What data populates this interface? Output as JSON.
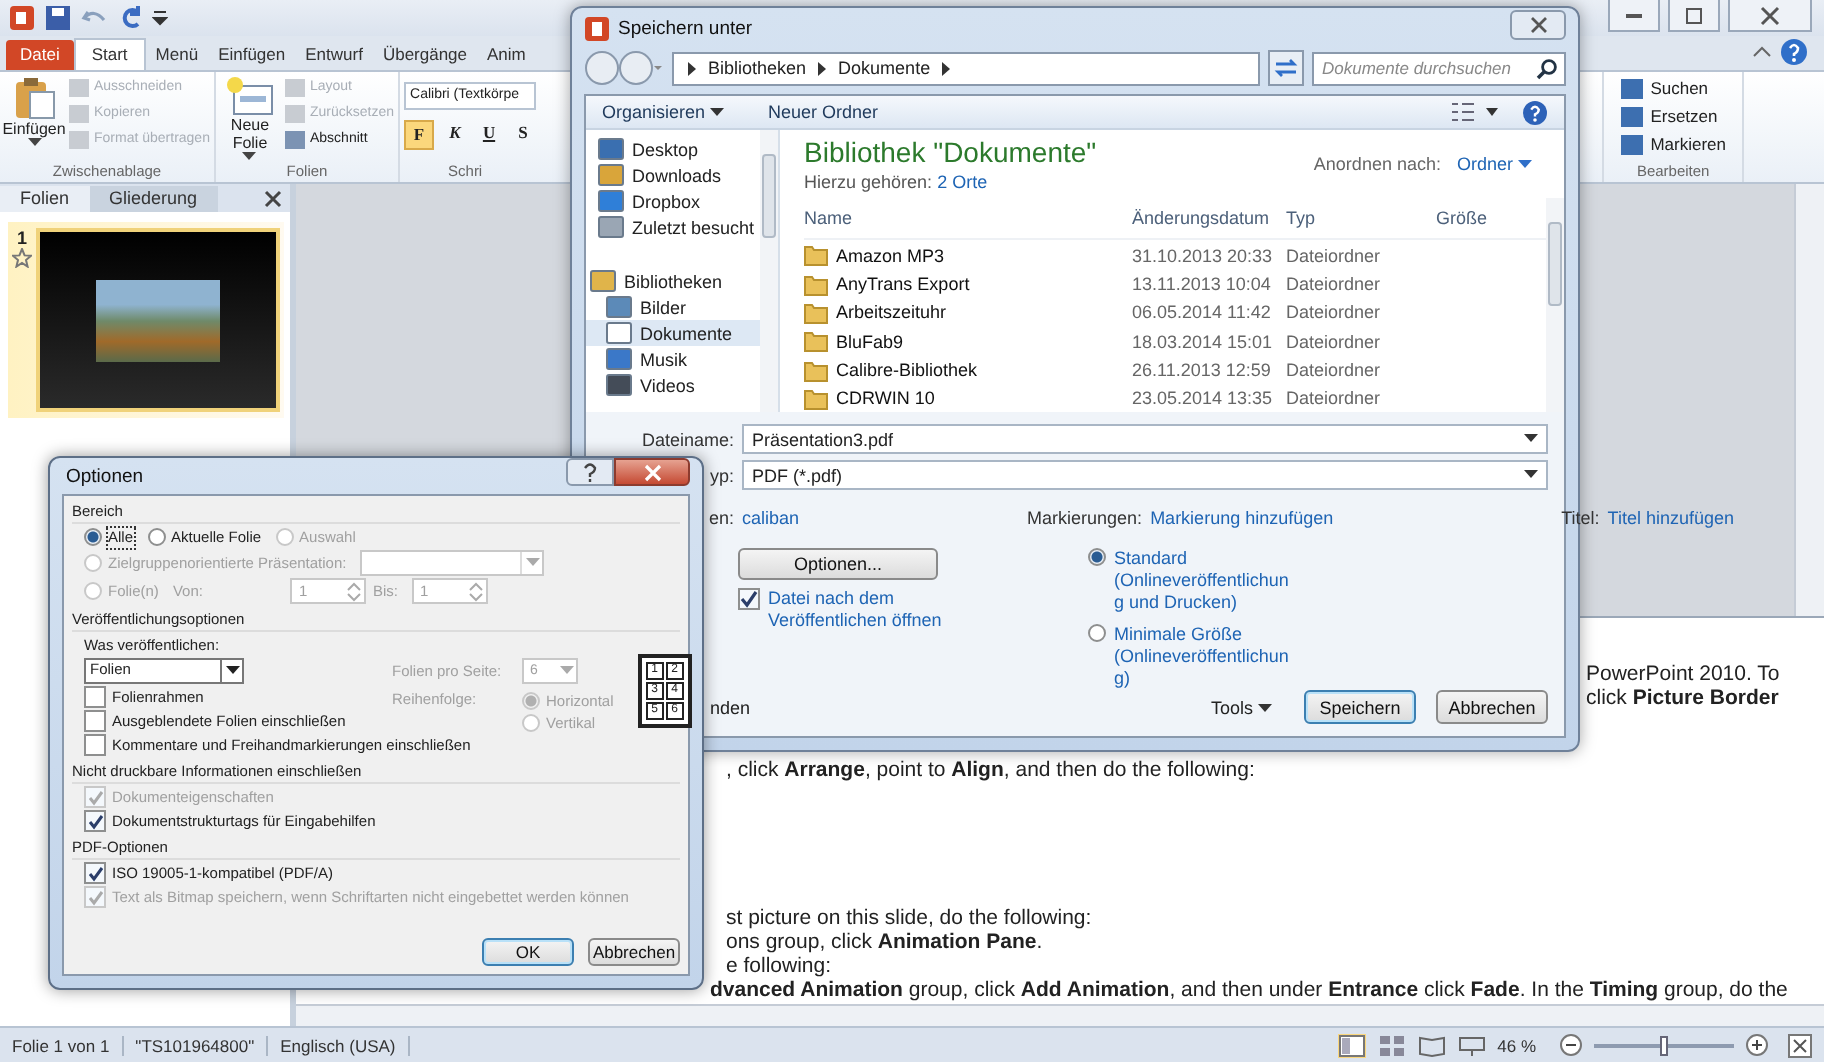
{
  "ppt": {
    "ribbon": {
      "tabs": [
        {
          "label": "Datei",
          "kind": "file",
          "selected": false
        },
        {
          "label": "Start",
          "kind": "tab",
          "selected": true
        },
        {
          "label": "Menü",
          "kind": "tab",
          "selected": false
        },
        {
          "label": "Einfügen",
          "kind": "tab",
          "selected": false
        },
        {
          "label": "Entwurf",
          "kind": "tab",
          "selected": false
        },
        {
          "label": "Übergänge",
          "kind": "tab",
          "selected": false
        },
        {
          "label": "Anim",
          "kind": "tab",
          "selected": false
        }
      ],
      "groups": [
        {
          "kind": "clipboard",
          "label": "Zwischenablage",
          "large": "Einfügen",
          "items": [
            {
              "label": "Ausschneiden",
              "disabled": true
            },
            {
              "label": "Kopieren",
              "disabled": true
            },
            {
              "label": "Format übertragen",
              "disabled": true
            }
          ]
        },
        {
          "kind": "slides",
          "label": "Folien",
          "large": "Neue Folie",
          "items": [
            {
              "label": "Layout",
              "disabled": true
            },
            {
              "label": "Zurücksetzen",
              "disabled": true
            },
            {
              "label": "Abschnitt",
              "disabled": false
            }
          ]
        },
        {
          "kind": "font",
          "label": "Schri",
          "font": "Calibri (Textkörpe",
          "buttons": [
            "F",
            "K",
            "U",
            "S"
          ]
        },
        {
          "kind": "edit",
          "label": "Bearbeiten",
          "items": [
            {
              "label": "Suchen",
              "disabled": false
            },
            {
              "label": "Ersetzen",
              "disabled": false
            },
            {
              "label": "Markieren",
              "disabled": false
            }
          ]
        }
      ]
    },
    "pane": {
      "tabs": [
        {
          "label": "Folien",
          "selected": true
        },
        {
          "label": "Gliederung",
          "selected": false
        }
      ],
      "slide_number": "1"
    },
    "notes": [
      {
        "kind": "right",
        "text": "PowerPoint 2010. To"
      },
      {
        "kind": "right",
        "text": "click **Picture Border**"
      },
      {
        "kind": "body",
        "text": ", click **Arrange**, point to **Align**, and then do the following:"
      },
      {
        "kind": "body",
        "text": "st picture on this slide, do the following:"
      },
      {
        "kind": "body",
        "text": "ons group, click **Animation Pane**."
      },
      {
        "kind": "body",
        "text": "e following:"
      },
      {
        "kind": "wide",
        "text": "**dvanced Animation** group, click **Add Animation**, and then under **Entrance** click **Fade**. In the **Timing** group, do the"
      }
    ],
    "status_bar": {
      "slide": "Folie 1 von 1",
      "theme": "\"TS101964800\"",
      "language": "Englisch (USA)",
      "zoom": "46 %",
      "zoom_slider": {
        "level": 0.5
      }
    }
  },
  "save_dialog": {
    "title": "Speichern unter",
    "breadcrumb": [
      "Bibliotheken",
      "Dokumente"
    ],
    "search": {
      "placeholder": "Dokumente durchsuchen"
    },
    "toolbar": {
      "organize": "Organisieren",
      "new_folder": "Neuer Ordner"
    },
    "nav": [
      {
        "label": "Desktop",
        "kind": "desktop",
        "selected": false
      },
      {
        "label": "Downloads",
        "kind": "downloads",
        "selected": false
      },
      {
        "label": "Dropbox",
        "kind": "dropbox",
        "selected": false
      },
      {
        "label": "Zuletzt besucht",
        "kind": "recent",
        "selected": false
      },
      {
        "label": "Bibliotheken",
        "kind": "libraries",
        "selected": false
      },
      {
        "label": "Bilder",
        "kind": "pictures",
        "selected": false
      },
      {
        "label": "Dokumente",
        "kind": "documents",
        "selected": true
      },
      {
        "label": "Musik",
        "kind": "music",
        "selected": false
      },
      {
        "label": "Videos",
        "kind": "videos",
        "selected": false
      }
    ],
    "library": {
      "title": "Bibliothek \"Dokumente\"",
      "includes_label": "Hierzu gehören:",
      "includes_link": "2 Orte",
      "sort_label": "Anordnen nach:",
      "sort_value": "Ordner"
    },
    "columns": [
      "Name",
      "Änderungsdatum",
      "Typ",
      "Größe"
    ],
    "rows": [
      {
        "name": "Amazon MP3",
        "date": "31.10.2013 20:33",
        "type": "Dateiordner"
      },
      {
        "name": "AnyTrans Export",
        "date": "13.11.2013 10:04",
        "type": "Dateiordner"
      },
      {
        "name": "Arbeitszeituhr",
        "date": "06.05.2014 11:42",
        "type": "Dateiordner"
      },
      {
        "name": "BluFab9",
        "date": "18.03.2014 15:01",
        "type": "Dateiordner"
      },
      {
        "name": "Calibre-Bibliothek",
        "date": "26.11.2013 12:59",
        "type": "Dateiordner"
      },
      {
        "name": "CDRWIN 10",
        "date": "23.05.2014 13:35",
        "type": "Dateiordner"
      }
    ],
    "fields": [
      {
        "label": "Dateiname:",
        "value": "Präsentation3.pdf"
      },
      {
        "label": "yp:",
        "value": "PDF (*.pdf)"
      }
    ],
    "meta": [
      {
        "label": "en:",
        "value": "caliban"
      },
      {
        "label": "Markierungen:",
        "value": "Markierung hinzufügen"
      },
      {
        "label": "Titel:",
        "value": "Titel hinzufügen"
      }
    ],
    "options_button": "Optionen...",
    "open_after": {
      "label": "Datei nach dem Veröffentlichen öffnen",
      "checked": true
    },
    "optimize": [
      {
        "label": "Standard (Onlineveröffentlichung und Drucken)",
        "selected": true
      },
      {
        "label": "Minimale Größe (Onlineveröffentlichung)",
        "selected": false
      }
    ],
    "hide_folders": "nden",
    "tools": "Tools",
    "buttons": [
      "Speichern",
      "Abbrechen"
    ]
  },
  "options_dialog": {
    "title": "Optionen",
    "range": {
      "heading": "Bereich",
      "choices": [
        {
          "label": "Alle",
          "selected": true,
          "disabled": false
        },
        {
          "label": "Aktuelle Folie",
          "selected": false,
          "disabled": false
        },
        {
          "label": "Auswahl",
          "selected": false,
          "disabled": true
        },
        {
          "label": "Zielgruppenorientierte Präsentation:",
          "selected": false,
          "disabled": true
        },
        {
          "label": "Folie(n)",
          "selected": false,
          "disabled": true
        }
      ],
      "from_label": "Von:",
      "from": "1",
      "to_label": "Bis:",
      "to": "1"
    },
    "publish": {
      "heading": "Veröffentlichungsoptionen",
      "what_label": "Was veröffentlichen:",
      "what": "Folien",
      "per_page_label": "Folien pro Seite:",
      "per_page": "6",
      "order_label": "Reihenfolge:",
      "order": [
        {
          "label": "Horizontal",
          "selected": true
        },
        {
          "label": "Vertikal",
          "selected": false
        }
      ],
      "layout_numbers": [
        "1",
        "2",
        "3",
        "4",
        "5",
        "6"
      ],
      "checks": [
        {
          "label": "Folienrahmen",
          "checked": false,
          "disabled": false
        },
        {
          "label": "Ausgeblendete Folien einschließen",
          "checked": false,
          "disabled": false
        },
        {
          "label": "Kommentare und Freihandmarkierungen einschließen",
          "checked": false,
          "disabled": false
        }
      ]
    },
    "nonprint": {
      "heading": "Nicht druckbare Informationen einschließen",
      "checks": [
        {
          "label": "Dokumenteigenschaften",
          "checked": true,
          "disabled": true
        },
        {
          "label": "Dokumentstrukturtags für Eingabehilfen",
          "checked": true,
          "disabled": false
        }
      ]
    },
    "pdf": {
      "heading": "PDF-Optionen",
      "checks": [
        {
          "label": "ISO 19005-1-kompatibel (PDF/A)",
          "checked": true,
          "disabled": false
        },
        {
          "label": "Text als Bitmap speichern, wenn Schriftarten nicht eingebettet werden können",
          "checked": true,
          "disabled": true
        }
      ]
    },
    "buttons": [
      "OK",
      "Abbrechen"
    ]
  }
}
